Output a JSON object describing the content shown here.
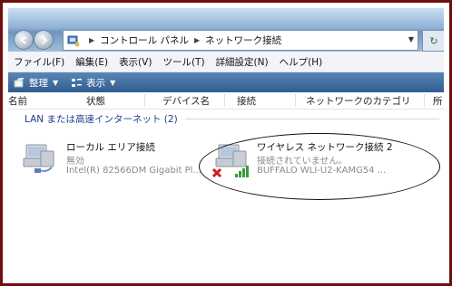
{
  "address": {
    "crumbs": [
      "コントロール パネル",
      "ネットワーク接続"
    ]
  },
  "menu": [
    "ファイル(F)",
    "編集(E)",
    "表示(V)",
    "ツール(T)",
    "詳細設定(N)",
    "ヘルプ(H)"
  ],
  "toolbar": {
    "organize": "整理",
    "view": "表示"
  },
  "columns": [
    "名前",
    "状態",
    "デバイス名",
    "接続",
    "ネットワークのカテゴリ",
    "所"
  ],
  "group": {
    "title": "LAN または高速インターネット (2)"
  },
  "connections": [
    {
      "name": "ローカル エリア接続",
      "status": "無効",
      "device": "Intel(R) 82566DM Gigabit Pl...",
      "icon": "wired-network-icon"
    },
    {
      "name": "ワイヤレス ネットワーク接続 2",
      "status": "接続されていません。",
      "device": "BUFFALO WLI-U2-KAMG54 ...",
      "icon": "wireless-network-icon",
      "error_icon": "red-x-icon",
      "signal_icon": "signal-bars-icon"
    }
  ],
  "colors": {
    "address_bar": "#8fb2d6",
    "toolbar": "#3d6a9c",
    "group_text": "#1e3f8a",
    "frame_border": "#6e0f0f"
  }
}
